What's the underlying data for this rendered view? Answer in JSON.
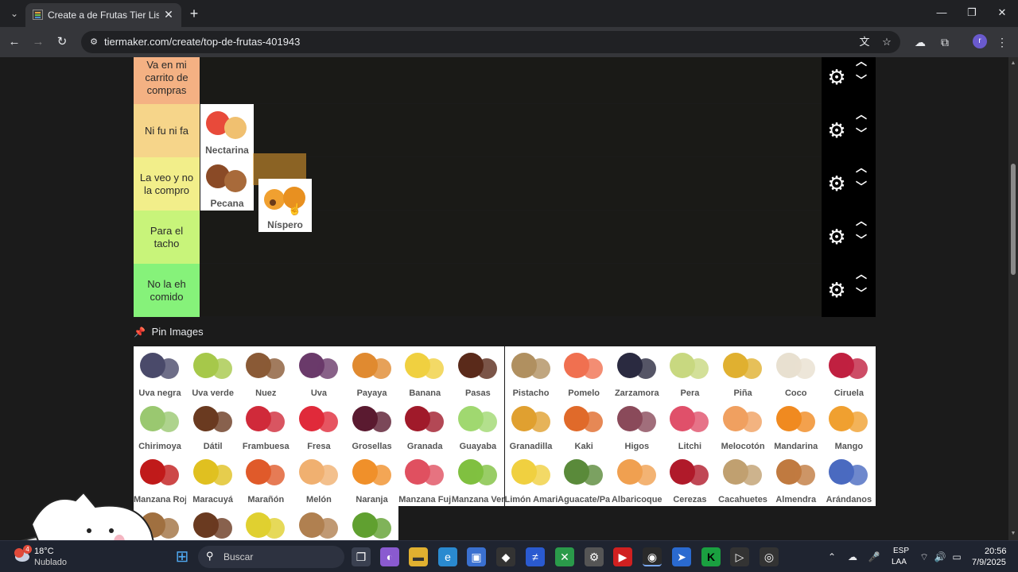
{
  "browser": {
    "tab_title": "Create a de Frutas Tier List - Tie",
    "url": "tiermaker.com/create/top-de-frutas-401943",
    "profile_initial": "r"
  },
  "tiers": [
    {
      "label": "Va en mi carrito de compras",
      "color": "#f4b183",
      "items": []
    },
    {
      "label": "Ni fu ni fa",
      "color": "#f6d58a",
      "items": [
        "Nectarina"
      ]
    },
    {
      "label": "La veo y no la compro",
      "color": "#f2ee8a",
      "items": [
        "Pecana"
      ]
    },
    {
      "label": "Para el tacho",
      "color": "#c8f47a",
      "items": []
    },
    {
      "label": "No la eh comido",
      "color": "#86f27a",
      "items": []
    }
  ],
  "dragging_item": "Níspero",
  "pin_images_label": "Pin Images",
  "pool": [
    "Uva negra",
    "Uva verde",
    "Nuez",
    "Uva",
    "Payaya",
    "Banana",
    "Pasas",
    "Pistacho",
    "Pomelo",
    "Zarzamora",
    "Pera",
    "Piña",
    "Coco",
    "Ciruela",
    "Chirimoya",
    "Dátil",
    "Frambuesa",
    "Fresa",
    "Grosellas",
    "Granada",
    "Guayaba",
    "Granadilla",
    "Kaki",
    "Higos",
    "Litchi",
    "Melocotón",
    "Mandarina",
    "Mango",
    "Manzana Roja",
    "Maracuyá",
    "Marañón",
    "Melón",
    "Naranja",
    "Manzana Fuji",
    "Manzana Verde",
    "Limón Amarillo",
    "Aguacate/Palta",
    "Albaricoque",
    "Cerezas",
    "Cacahuetes",
    "Almendra",
    "Arándanos",
    "",
    "",
    "",
    "",
    ""
  ],
  "pool_colors": [
    "#4a4a6a",
    "#a6c84a",
    "#8a5a36",
    "#6a3a6a",
    "#e08a30",
    "#f0d040",
    "#5a2a1a",
    "#b09060",
    "#f07050",
    "#2a2a40",
    "#c8d880",
    "#e0b030",
    "#e8e0d0",
    "#c02040",
    "#9ac870",
    "#6a3a20",
    "#d02a3a",
    "#e02a3a",
    "#5a1a30",
    "#a01a2a",
    "#a0d870",
    "#e0a030",
    "#e06a2a",
    "#8a4a5a",
    "#e0506a",
    "#f0a060",
    "#f08a20",
    "#f0a030",
    "#c01a1a",
    "#e0c020",
    "#e05a2a",
    "#f0b070",
    "#f0902a",
    "#e05060",
    "#80c040",
    "#f0d040",
    "#5a8a3a",
    "#f0a050",
    "#b01a2a",
    "#c0a070",
    "#c07a40",
    "#4a6ac0",
    "#a07040",
    "#6a3a20",
    "#e0d030",
    "#b08050",
    "#60a030"
  ],
  "taskbar": {
    "temp": "18°C",
    "weather": "Nublado",
    "search_placeholder": "Buscar",
    "lang_top": "ESP",
    "lang_bottom": "LAA",
    "time": "20:56",
    "date": "7/9/2025",
    "badge": "4"
  }
}
